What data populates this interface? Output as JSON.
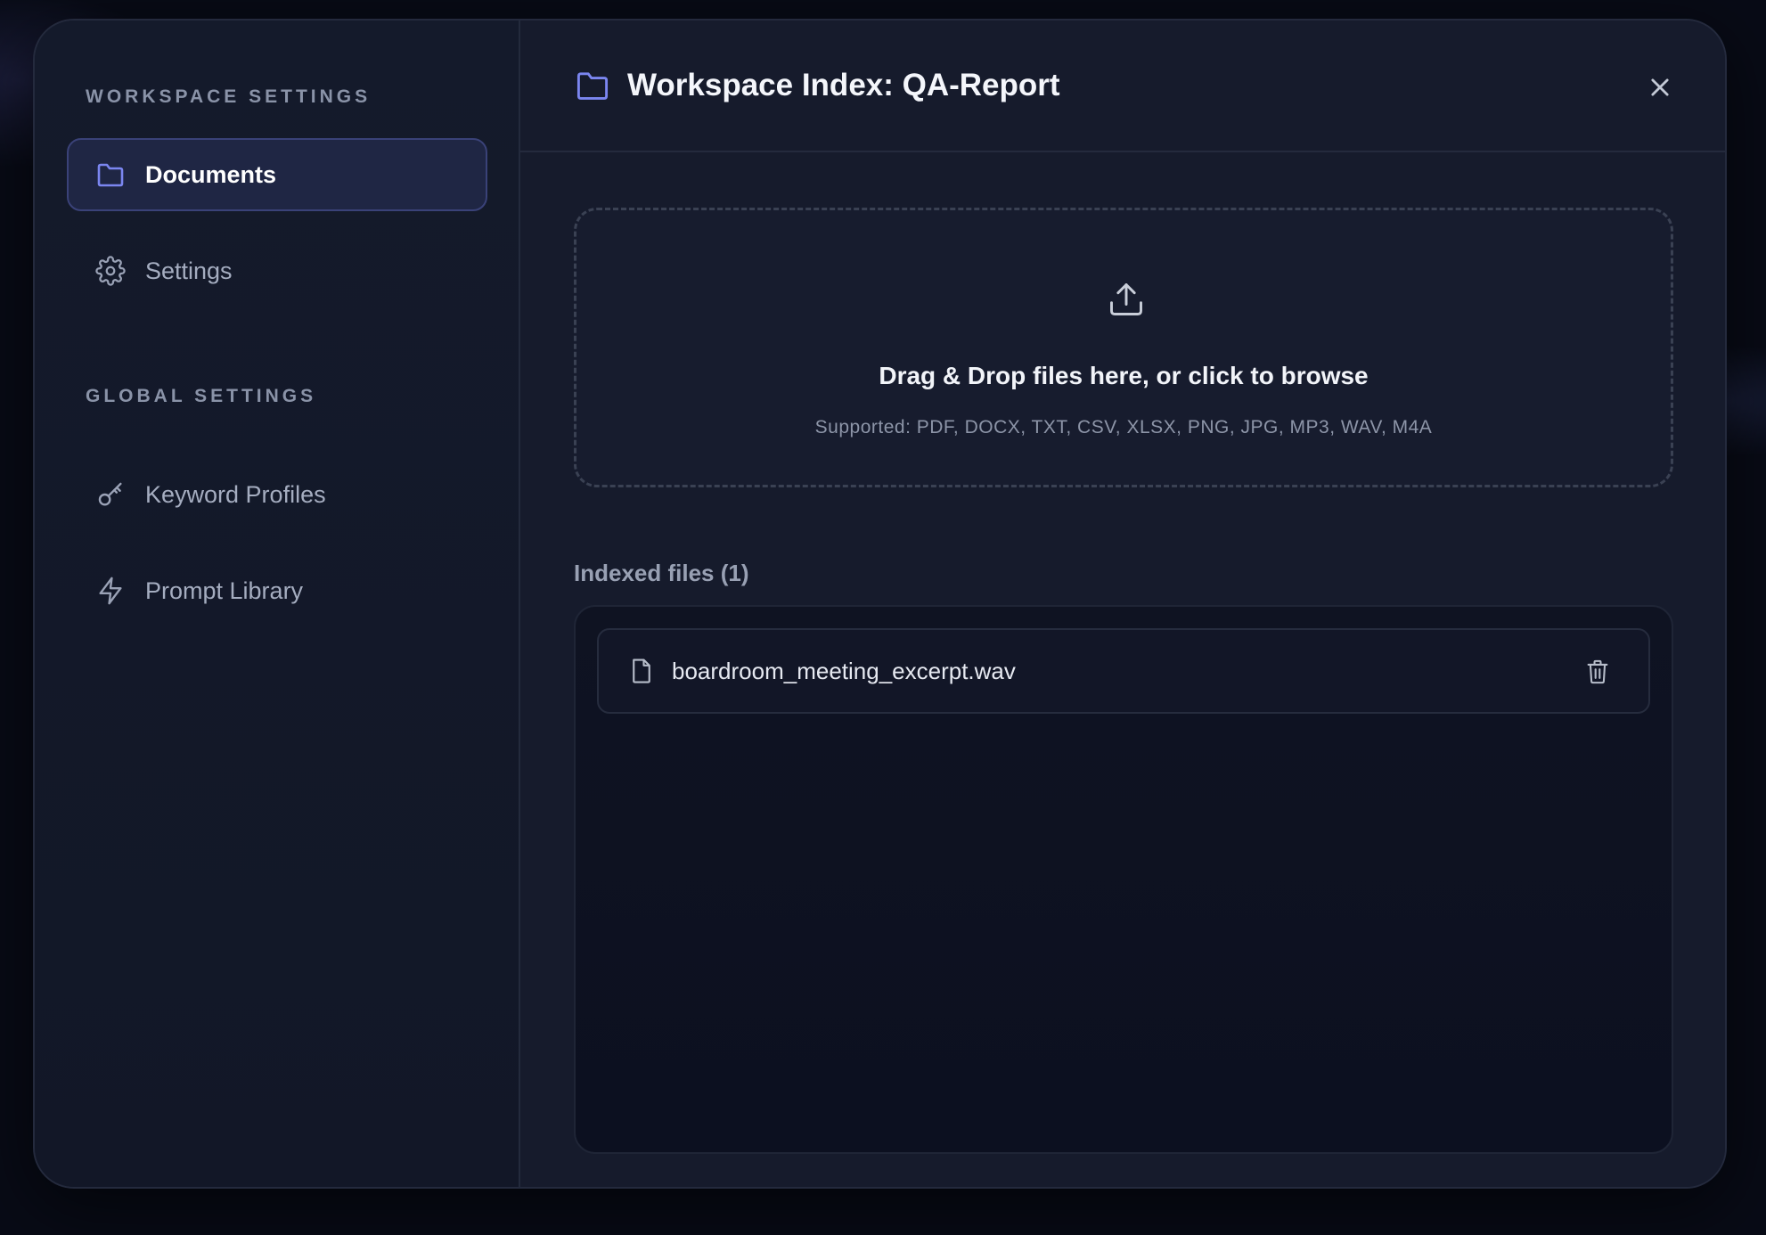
{
  "sidebar": {
    "workspace_section_label": "WORKSPACE SETTINGS",
    "global_section_label": "GLOBAL SETTINGS",
    "items": [
      {
        "label": "Documents",
        "icon": "folder-icon",
        "active": true
      },
      {
        "label": "Settings",
        "icon": "gear-icon",
        "active": false
      },
      {
        "label": "Keyword Profiles",
        "icon": "key-icon",
        "active": false
      },
      {
        "label": "Prompt Library",
        "icon": "lightning-icon",
        "active": false
      }
    ]
  },
  "header": {
    "title": "Workspace Index: QA-Report",
    "icon": "folder-icon",
    "close_icon": "close-icon"
  },
  "dropzone": {
    "icon": "upload-icon",
    "title": "Drag & Drop files here, or click to browse",
    "supported": "Supported: PDF, DOCX, TXT, CSV, XLSX, PNG, JPG, MP3, WAV, M4A"
  },
  "files": {
    "label": "Indexed files (1)",
    "items": [
      {
        "name": "boardroom_meeting_excerpt.wav",
        "icon": "file-icon",
        "action_icon": "trash-icon"
      }
    ]
  },
  "colors": {
    "accent": "#7b86f0",
    "background": "#080b16",
    "panel": "#151a2b",
    "active_item": "#1f2644"
  }
}
